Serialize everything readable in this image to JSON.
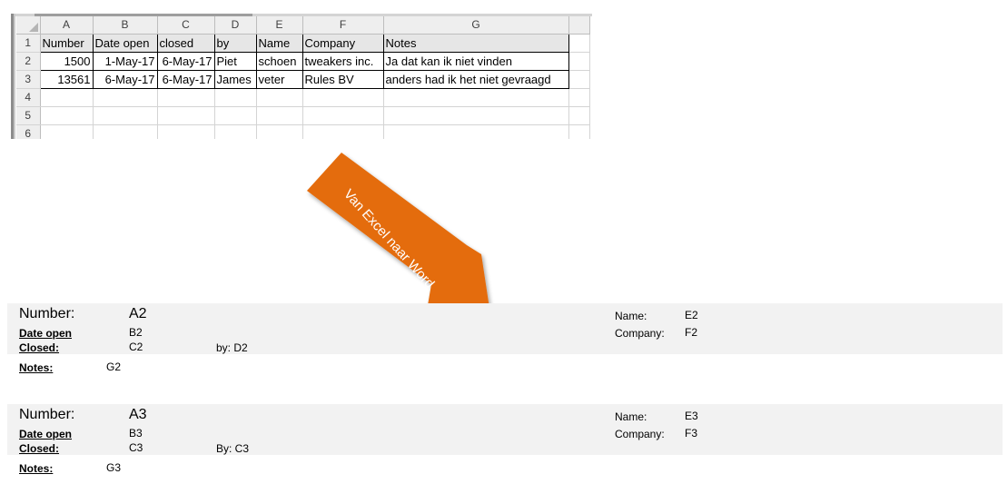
{
  "excel": {
    "column_headers": [
      "A",
      "B",
      "C",
      "D",
      "E",
      "F",
      "G"
    ],
    "row_numbers": [
      "1",
      "2",
      "3",
      "4",
      "5",
      "6"
    ],
    "rows": [
      [
        "Number",
        "Date open",
        "closed",
        "by",
        "Name",
        "Company",
        "Notes"
      ],
      [
        "1500",
        "1-May-17",
        "6-May-17",
        "Piet",
        "schoen",
        "tweakers inc.",
        "Ja dat kan ik niet vinden"
      ],
      [
        "13561",
        "6-May-17",
        "6-May-17",
        "James",
        "veter",
        "Rules BV",
        "anders had ik het niet gevraagd"
      ],
      [
        "",
        "",
        "",
        "",
        "",
        "",
        ""
      ],
      [
        "",
        "",
        "",
        "",
        "",
        "",
        ""
      ],
      [
        "",
        "",
        "",
        "",
        "",
        "",
        ""
      ]
    ]
  },
  "arrow": {
    "label": "Van Excel naar Word",
    "color": "#E46C0A"
  },
  "records": [
    {
      "number_label": "Number:",
      "number_value": "A2",
      "date_open_label": "Date open",
      "date_open_value": "B2",
      "closed_label": "Closed:",
      "closed_value": "C2",
      "by_text": "by: D2",
      "notes_label": "Notes:",
      "notes_value": "G2",
      "name_label": "Name:",
      "name_value": "E2",
      "company_label": "Company:",
      "company_value": "F2"
    },
    {
      "number_label": "Number:",
      "number_value": "A3",
      "date_open_label": "Date open",
      "date_open_value": "B3",
      "closed_label": "Closed:",
      "closed_value": "C3",
      "by_text": "By: C3",
      "notes_label": "Notes:",
      "notes_value": "G3",
      "name_label": "Name:",
      "name_value": "E3",
      "company_label": "Company:",
      "company_value": "F3"
    }
  ]
}
